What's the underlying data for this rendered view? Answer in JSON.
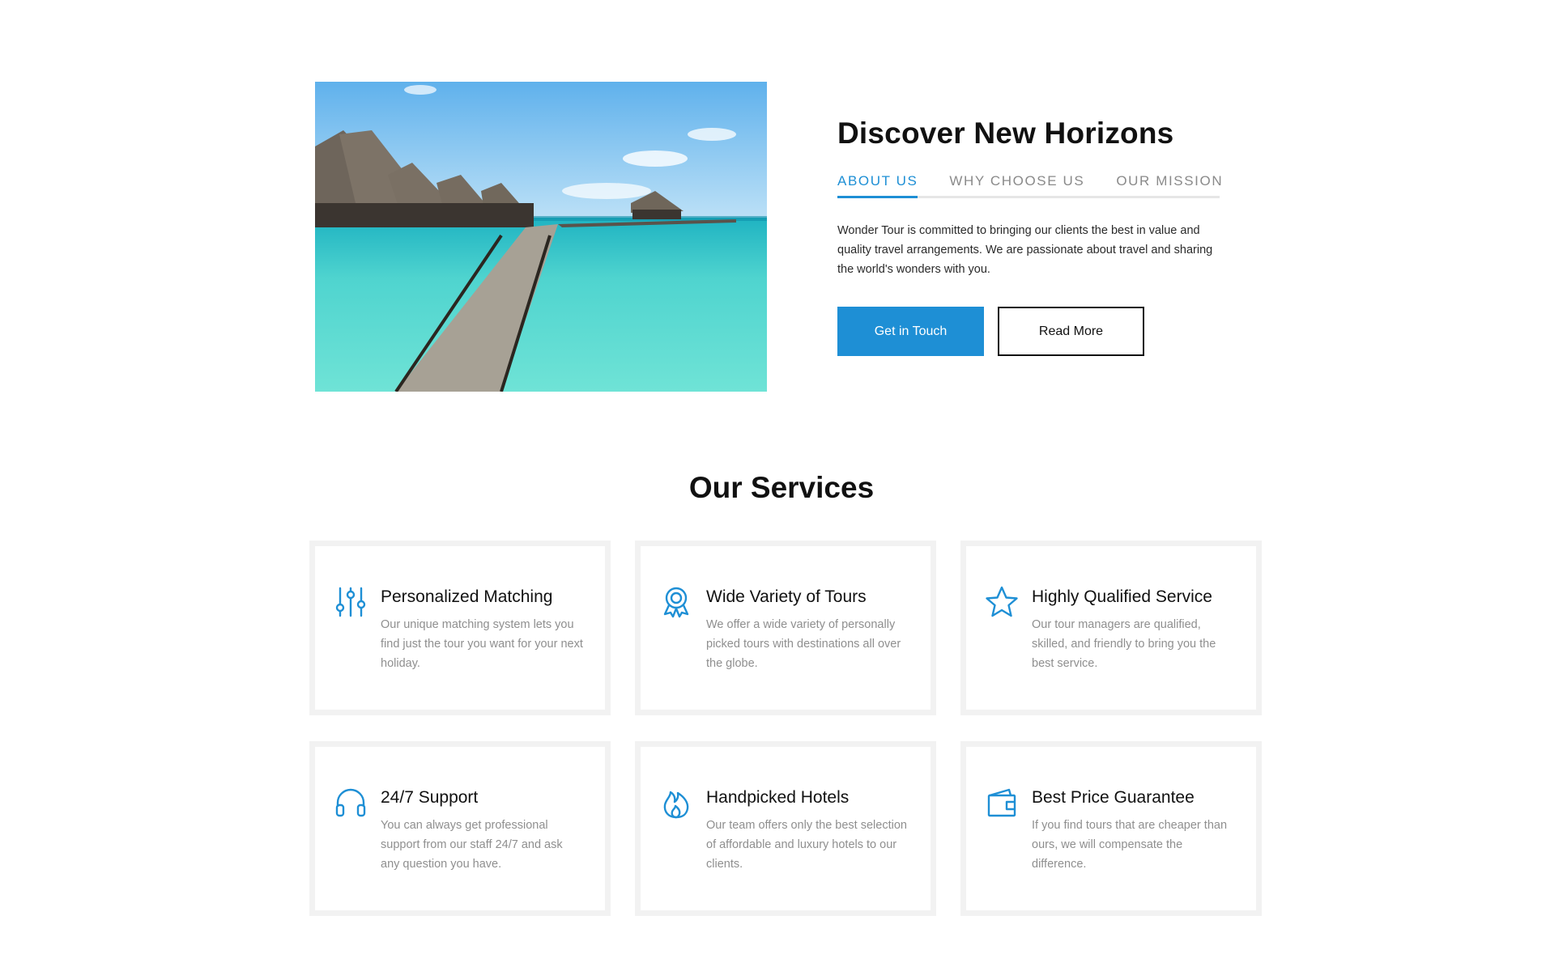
{
  "about": {
    "title": "Discover New Horizons",
    "tabs": [
      {
        "label": "ABOUT US",
        "active": true
      },
      {
        "label": "WHY CHOOSE US",
        "active": false
      },
      {
        "label": "OUR MISSION",
        "active": false
      }
    ],
    "text": "Wonder Tour is committed to bringing our clients the best in value and quality travel arrangements. We are passionate about travel and sharing the world's wonders with you.",
    "primary_button": "Get in Touch",
    "secondary_button": "Read More"
  },
  "services": {
    "title": "Our Services",
    "items": [
      {
        "icon": "sliders-icon",
        "title": "Personalized Matching",
        "text": "Our unique matching system lets you find just the tour you want for your next holiday."
      },
      {
        "icon": "award-icon",
        "title": "Wide Variety of Tours",
        "text": "We offer a wide variety of personally picked tours with destinations all over the globe."
      },
      {
        "icon": "star-icon",
        "title": "Highly Qualified Service",
        "text": "Our tour managers are qualified, skilled, and friendly to bring you the best service."
      },
      {
        "icon": "headphones-icon",
        "title": "24/7 Support",
        "text": "You can always get professional support from our staff 24/7 and ask any question you have."
      },
      {
        "icon": "flame-icon",
        "title": "Handpicked Hotels",
        "text": "Our team offers only the best selection of affordable and luxury hotels to our clients."
      },
      {
        "icon": "wallet-icon",
        "title": "Best Price Guarantee",
        "text": "If you find tours that are cheaper than ours, we will compensate the difference."
      }
    ]
  },
  "colors": {
    "accent": "#1e8fd5",
    "card_border": "#f2f2f2",
    "muted_text": "#8f8f8f"
  }
}
